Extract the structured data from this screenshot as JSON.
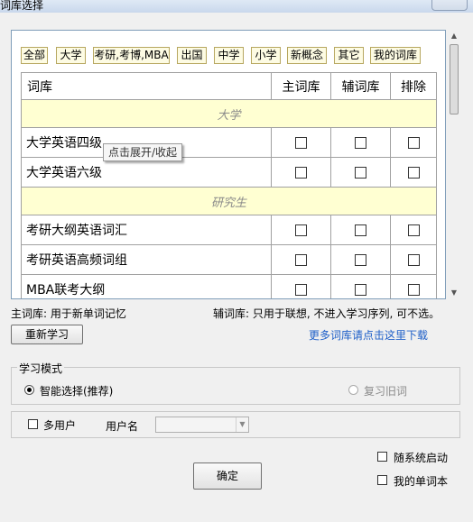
{
  "window": {
    "title": "词库选择"
  },
  "filters": [
    "全部",
    "大学",
    "考研,考博,MBA",
    "出国",
    "中学",
    "小学",
    "新概念",
    "其它",
    "我的词库"
  ],
  "table": {
    "headers": {
      "name": "词库",
      "main": "主词库",
      "aux": "辅词库",
      "exclude": "排除"
    },
    "categories": {
      "university": "大学",
      "graduate": "研究生"
    },
    "rows": [
      "大学英语四级",
      "大学英语六级",
      "考研大纲英语词汇",
      "考研英语高频词组",
      "MBA联考大纲"
    ]
  },
  "tooltip": "点击展开/收起",
  "notes": {
    "main": "主词库: 用于新单词记忆",
    "aux": "辅词库: 只用于联想, 不进入学习序列, 可不选。"
  },
  "buttons": {
    "relearn": "重新学习",
    "ok": "确定"
  },
  "link": "更多词库请点击这里下载",
  "study_mode": {
    "legend": "学习模式",
    "smart": "智能选择(推荐)",
    "review": "复习旧词"
  },
  "multi_user": {
    "label": "多用户",
    "username_label": "用户名",
    "username_value": ""
  },
  "options": {
    "autostart": "随系统启动",
    "my_words": "我的单词本"
  },
  "colors": {
    "filter_bg": "#fdfbe3",
    "category_bg": "#ffffd2",
    "link": "#1e5fc8"
  }
}
